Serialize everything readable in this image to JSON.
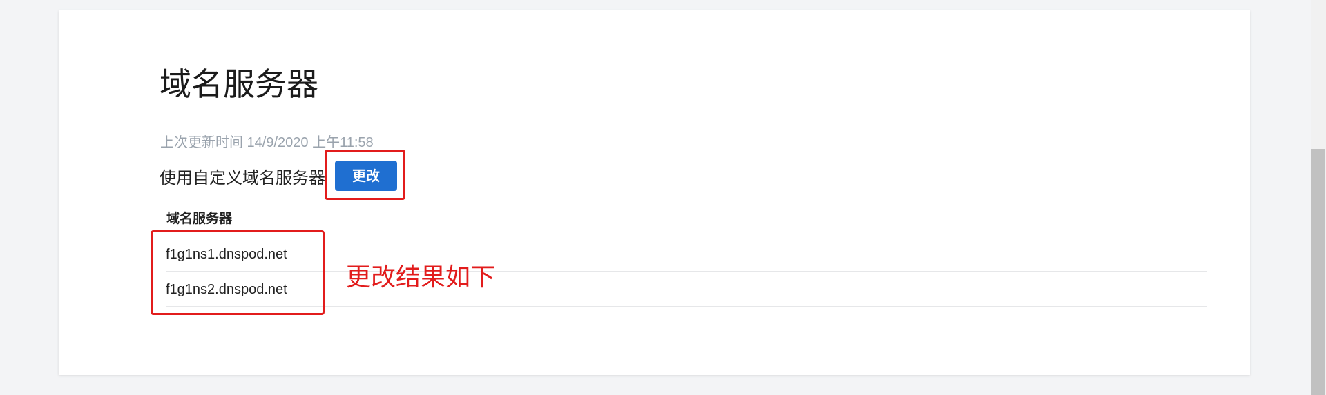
{
  "section": {
    "title": "域名服务器",
    "last_updated": "上次更新时间 14/9/2020 上午11:58",
    "custom_label": "使用自定义域名服务器",
    "change_button_label": "更改"
  },
  "table": {
    "header": "域名服务器",
    "rows": [
      "f1g1ns1.dnspod.net",
      "f1g1ns2.dnspod.net"
    ]
  },
  "annotation": {
    "note": "更改结果如下",
    "color": "#e21c1c"
  },
  "colors": {
    "button": "#1f6fd1",
    "background": "#f3f4f6"
  }
}
